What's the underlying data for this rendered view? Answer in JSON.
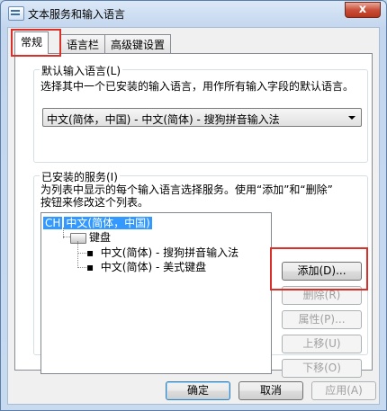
{
  "window": {
    "title": "文本服务和输入语言",
    "close_glyph": "x"
  },
  "tabs": [
    {
      "label": "常规"
    },
    {
      "label": "语言栏"
    },
    {
      "label": "高级键设置"
    }
  ],
  "default_lang": {
    "legend": "默认输入语言(L)",
    "description": "选择其中一个已安装的输入语言，用作所有输入字段的默认语言。",
    "selected": "中文(简体，中国) - 中文(简体) - 搜狗拼音输入法"
  },
  "services": {
    "legend": "已安装的服务(I)",
    "description_line1": "为列表中显示的每个输入语言选择服务。使用“添加”和“删除”",
    "description_line2": "按钮来修改这个列表。",
    "tree": {
      "lang_code": "CH",
      "lang_name": "中文(简体，中国)",
      "category": "键盘",
      "items": [
        "中文(简体) - 搜狗拼音输入法",
        "中文(简体) - 美式键盘"
      ]
    },
    "buttons": {
      "add": "添加(D)...",
      "remove": "删除(R)",
      "properties": "属性(P)...",
      "move_up": "上移(U)",
      "move_down": "下移(O)"
    }
  },
  "footer": {
    "ok": "确定",
    "cancel": "取消",
    "apply": "应用(A)"
  },
  "colors": {
    "highlight": "#d9312a",
    "selection": "#3399ff"
  }
}
